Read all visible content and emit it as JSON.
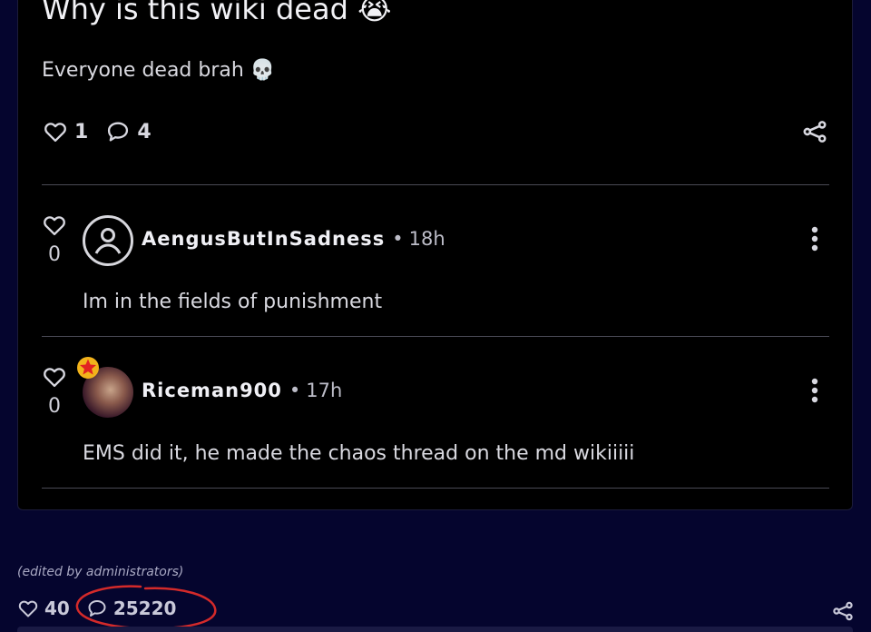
{
  "post": {
    "title": "Why is this wiki dead 😭",
    "body": "Everyone dead brah 💀",
    "like_count": "1",
    "comment_count": "4"
  },
  "comments": [
    {
      "username": "AengusButInSadness",
      "separator": "•",
      "time": "18h",
      "text": "Im in the fields of punishment",
      "likes": "0"
    },
    {
      "username": "Riceman900",
      "separator": "•",
      "time": "17h",
      "text": "EMS did it, he made the chaos thread on the md wikiiiii",
      "likes": "0"
    }
  ],
  "footer": {
    "edited_note": "(edited by administrators)",
    "like_count": "40",
    "comment_count": "25220"
  },
  "colors": {
    "background": "#05052e",
    "card": "#000000",
    "annotation": "#d42a2a",
    "badge_star": "#e22222",
    "badge_ring": "#f2b31b"
  },
  "icons": [
    "heart-icon",
    "comment-icon",
    "share-icon",
    "user-icon",
    "more-vertical-icon",
    "star-badge-icon"
  ]
}
